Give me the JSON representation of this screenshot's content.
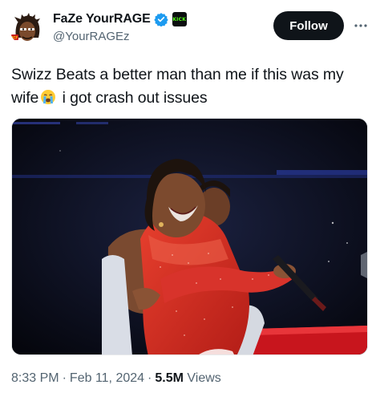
{
  "author": {
    "display_name": "FaZe YourRAGE",
    "handle": "@YourRAGEz",
    "badge_text": "KICK",
    "avatar_icon": "avatar-cartoon-icon",
    "verified_icon": "verified-check-icon"
  },
  "actions": {
    "follow_label": "Follow",
    "more_icon": "more-horizontal-icon"
  },
  "tweet": {
    "text_part1": "Swizz Beats a better man than me if this was my wife",
    "emoji_icon": "loudly-crying-face-icon",
    "text_part2": " i got crash out issues"
  },
  "media": {
    "type": "photo",
    "description_icon": "photo-performers-embrace"
  },
  "meta": {
    "time": "8:33 PM",
    "separator": "·",
    "date": "Feb 11, 2024",
    "views_count": "5.5M",
    "views_label": " Views"
  },
  "colors": {
    "primary_text": "#0f1419",
    "secondary_text": "#536471",
    "verified_blue": "#1d9bf0",
    "kick_green": "#53fc18",
    "button_black": "#0f1419"
  }
}
